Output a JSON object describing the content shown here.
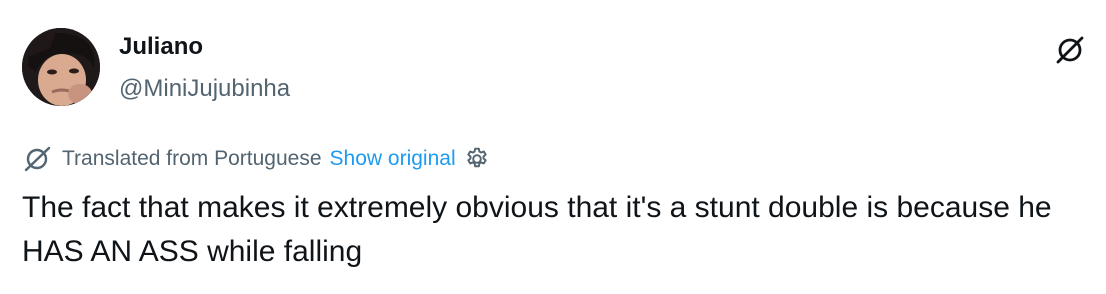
{
  "tweet": {
    "author": {
      "display_name": "Juliano",
      "handle": "@MiniJujubinha"
    },
    "translation": {
      "label": "Translated from Portuguese",
      "show_original": "Show original"
    },
    "text": "The fact that makes it extremely obvious that it's a stunt double is because he HAS AN ASS while falling"
  },
  "icons": {
    "grok": "grok-icon",
    "translate": "grok-translate-icon",
    "settings": "gear-icon"
  },
  "colors": {
    "text_primary": "#0f1419",
    "text_secondary": "#536471",
    "link": "#1d9bf0"
  }
}
